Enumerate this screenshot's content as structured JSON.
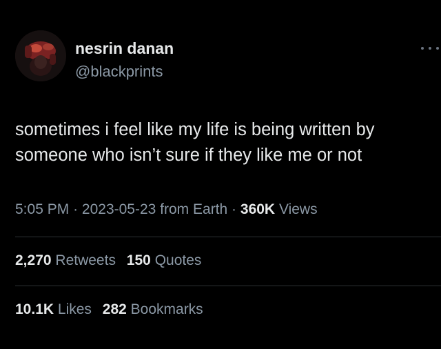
{
  "user": {
    "display_name": "nesrin danan",
    "handle": "@blackprints",
    "avatar_icon": "profile-avatar"
  },
  "tweet": {
    "text_lines": [
      "sometimes i feel like my life is being written by",
      "someone who isn’t sure if they like me or not"
    ]
  },
  "meta": {
    "time": "5:05 PM",
    "separator": "·",
    "date": "2023-05-23",
    "source": "from Earth",
    "views_count": "360K",
    "views_label": "Views"
  },
  "stats": {
    "retweets_count": "2,270",
    "retweets_label": "Retweets",
    "quotes_count": "150",
    "quotes_label": "Quotes",
    "likes_count": "10.1K",
    "likes_label": "Likes",
    "bookmarks_count": "282",
    "bookmarks_label": "Bookmarks"
  },
  "colors": {
    "background": "#000000",
    "primary_text": "#e7e9ea",
    "secondary_text": "#8b98a5",
    "divider": "#2f3336"
  },
  "icons": {
    "more": "more-options-icon"
  }
}
